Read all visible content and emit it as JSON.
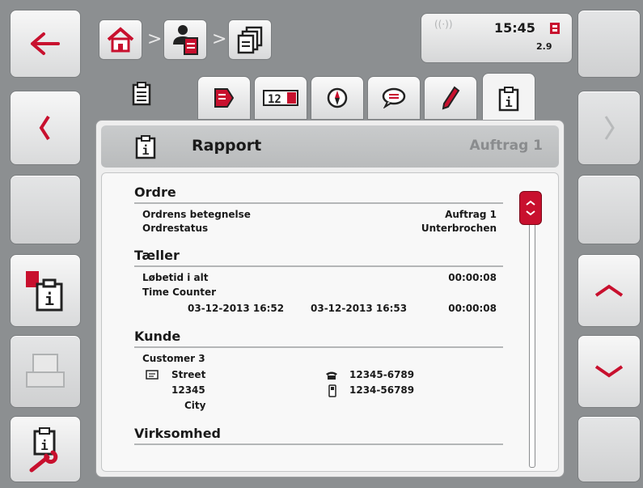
{
  "status": {
    "time": "15:45",
    "version": "2.9"
  },
  "panel": {
    "title": "Rapport",
    "subtitle": "Auftrag 1"
  },
  "sections": {
    "ordre": {
      "heading": "Ordre",
      "name_label": "Ordrens betegnelse",
      "name_value": "Auftrag 1",
      "status_label": "Ordrestatus",
      "status_value": "Unterbrochen"
    },
    "taeller": {
      "heading": "Tæller",
      "runtime_label": "Løbetid i alt",
      "runtime_value": "00:00:08",
      "counter_label": "Time Counter",
      "counter_start": "03-12-2013 16:52",
      "counter_end": "03-12-2013 16:53",
      "counter_value": "00:00:08"
    },
    "kunde": {
      "heading": "Kunde",
      "name": "Customer 3",
      "street": "Street",
      "zip": "12345",
      "city": "City",
      "phone": "12345-6789",
      "mobile": "1234-56789"
    },
    "virksomhed": {
      "heading": "Virksomhed"
    }
  },
  "colors": {
    "accent": "#c8102e",
    "background": "#8c8f91"
  }
}
